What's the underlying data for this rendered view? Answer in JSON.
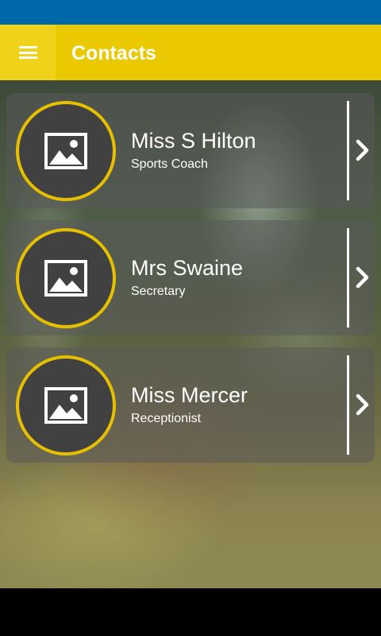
{
  "app": {
    "title": "Contacts",
    "menu_icon": "hamburger-menu-icon",
    "colors": {
      "status_bar": "#0067a8",
      "app_bar": "#ebc900",
      "avatar_ring": "#e6c000",
      "avatar_fill": "#414141"
    }
  },
  "contacts": [
    {
      "name": "Miss S Hilton",
      "role": "Sports Coach",
      "avatar_icon": "image-placeholder-icon",
      "action_icon": "chevron-right-icon"
    },
    {
      "name": "Mrs Swaine",
      "role": "Secretary",
      "avatar_icon": "image-placeholder-icon",
      "action_icon": "chevron-right-icon"
    },
    {
      "name": "Miss Mercer",
      "role": "Receptionist",
      "avatar_icon": "image-placeholder-icon",
      "action_icon": "chevron-right-icon"
    }
  ]
}
